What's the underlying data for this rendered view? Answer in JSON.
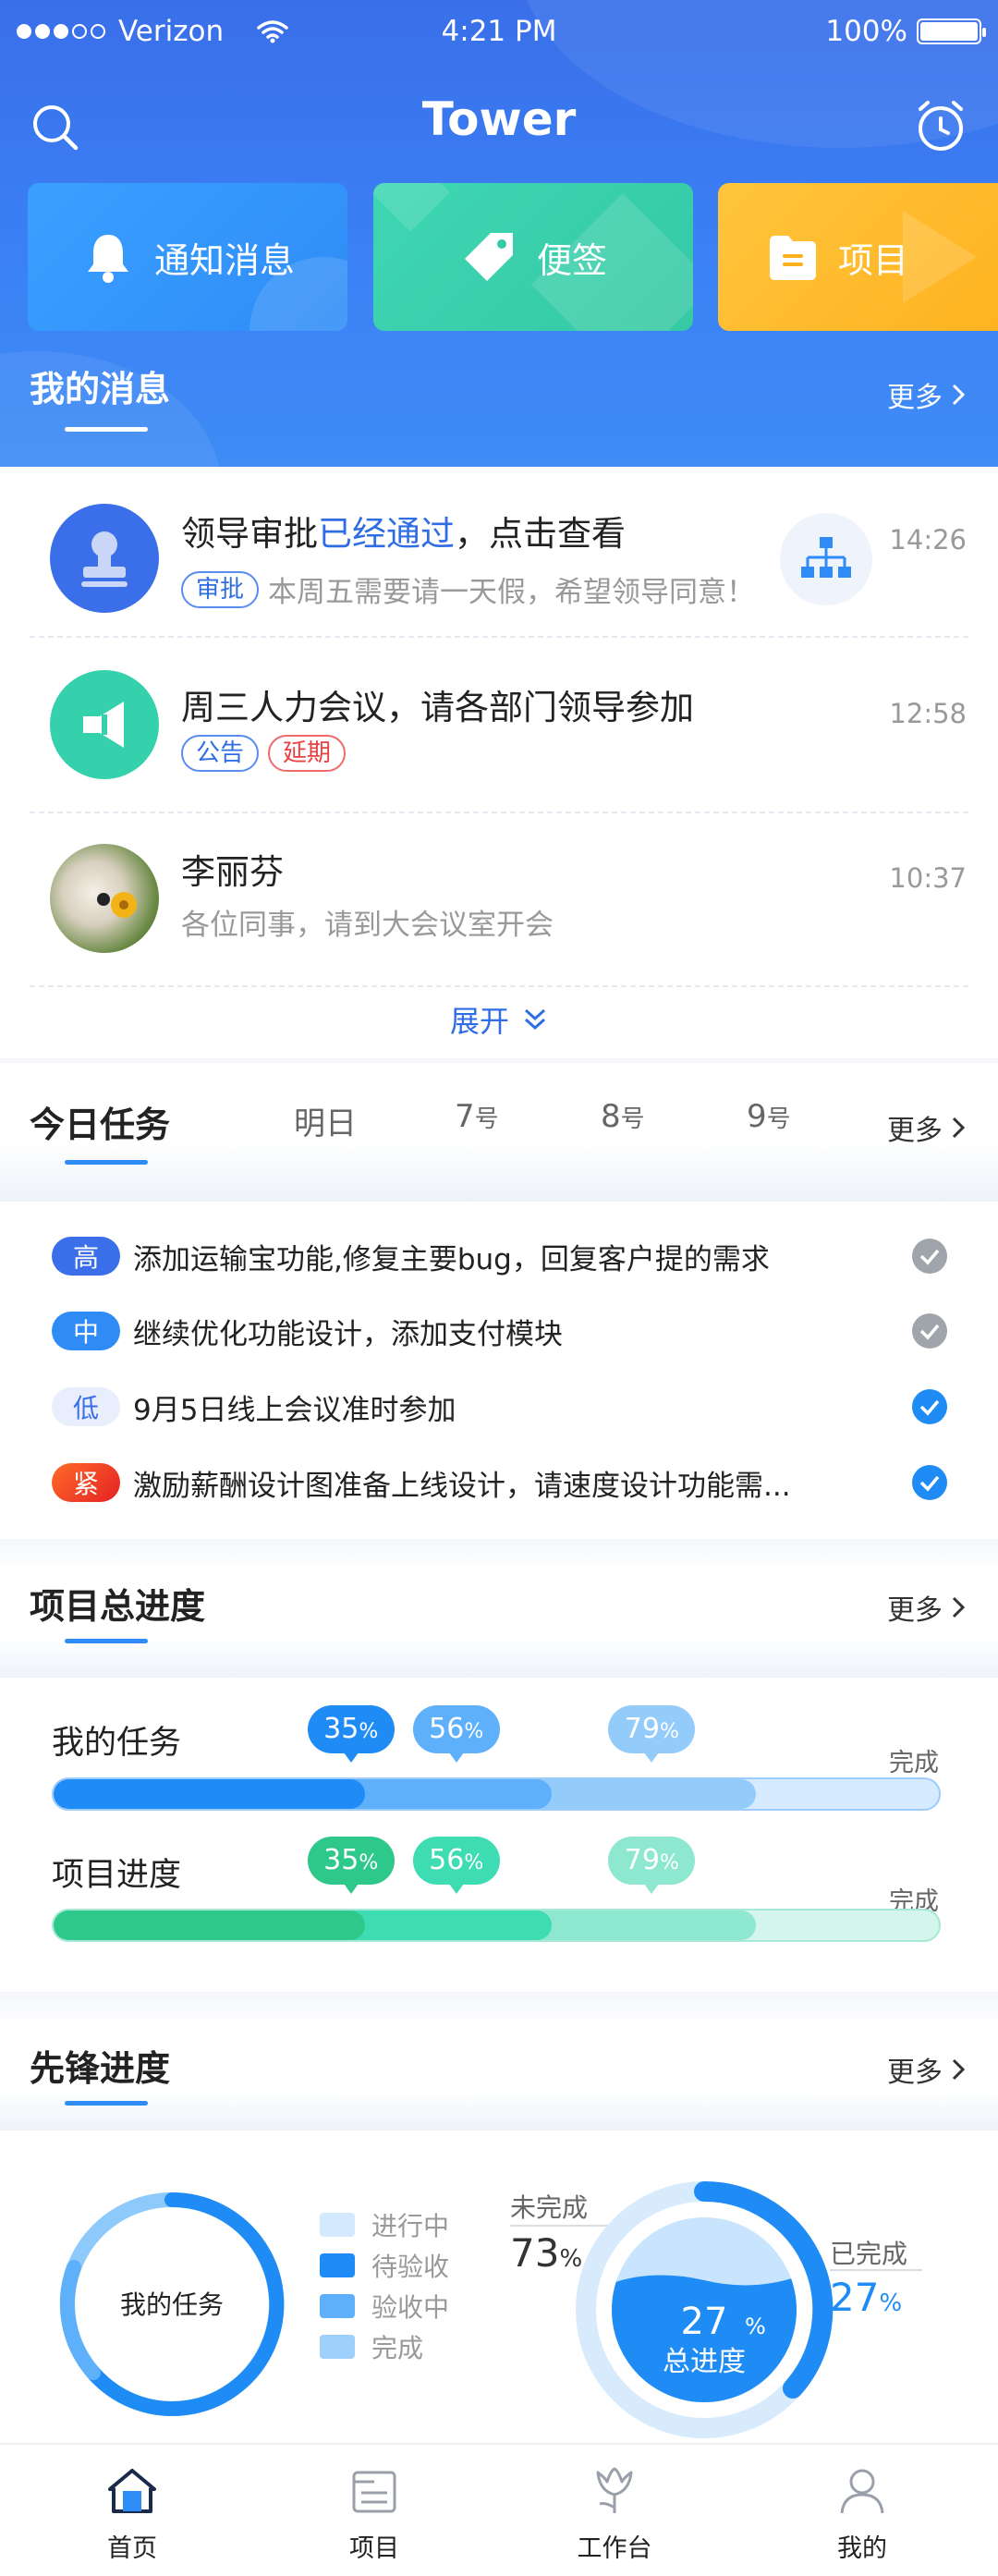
{
  "status_bar": {
    "carrier": "Verizon",
    "time": "4:21 PM",
    "battery": "100%"
  },
  "navbar": {
    "title": "Tower"
  },
  "quick_actions": [
    {
      "label": "通知消息",
      "icon": "bell-icon"
    },
    {
      "label": "便签",
      "icon": "tag-icon"
    },
    {
      "label": "项目",
      "icon": "folder-icon"
    }
  ],
  "messages_section": {
    "title": "我的消息",
    "more": "更多",
    "expand": "展开",
    "items": [
      {
        "title_a": "领导审批",
        "title_highlight": "已经通过",
        "title_b": "，点击查看",
        "tag": "审批",
        "subtitle": "本周五需要请一天假，希望领导同意！",
        "time": "14:26"
      },
      {
        "title": "周三人力会议，请各部门领导参加",
        "tags": [
          "公告",
          "延期"
        ],
        "time": "12:58"
      },
      {
        "title": "李丽芬",
        "subtitle": "各位同事，请到大会议室开会",
        "time": "10:37"
      }
    ]
  },
  "tasks_section": {
    "tabs": [
      {
        "label": "今日任务"
      },
      {
        "label": "明日"
      },
      {
        "num": "7",
        "unit": "号"
      },
      {
        "num": "8",
        "unit": "号"
      },
      {
        "num": "9",
        "unit": "号"
      }
    ],
    "more": "更多",
    "items": [
      {
        "priority": "高",
        "text": "添加运输宝功能,修复主要bug，回复客户提的需求",
        "done": false
      },
      {
        "priority": "中",
        "text": "继续优化功能设计，添加支付模块",
        "done": false
      },
      {
        "priority": "低",
        "text": "9月5日线上会议准时参加",
        "done": true
      },
      {
        "priority": "紧",
        "text": "激励薪酬设计图准备上线设计，请速度设计功能需...",
        "done": true
      }
    ]
  },
  "project_section": {
    "title": "项目总进度",
    "more": "更多",
    "rows": [
      {
        "label": "我的任务",
        "values": [
          35,
          56,
          79
        ],
        "done_label": "完成"
      },
      {
        "label": "项目进度",
        "values": [
          35,
          56,
          79
        ],
        "done_label": "完成"
      }
    ],
    "percent_unit": "%"
  },
  "pioneer_section": {
    "title": "先锋进度",
    "more": "更多",
    "donut_label": "我的任务",
    "legend": [
      "进行中",
      "待验收",
      "验收中",
      "完成"
    ],
    "incomplete_label": "未完成",
    "incomplete_value": "73",
    "complete_label": "已完成",
    "complete_value": "27",
    "total_value": "27",
    "total_label": "总进度",
    "percent_unit": "%"
  },
  "tabbar": [
    {
      "label": "首页",
      "icon": "home-icon",
      "active": true
    },
    {
      "label": "项目",
      "icon": "file-list-icon",
      "active": false
    },
    {
      "label": "工作台",
      "icon": "tulip-icon",
      "active": false
    },
    {
      "label": "我的",
      "icon": "user-icon",
      "active": false
    }
  ],
  "colors": {
    "primary": "#2f8cf7",
    "header": "#3a6fe9",
    "green": "#35c9a4",
    "orange": "#ffb21f",
    "red": "#e94040"
  }
}
